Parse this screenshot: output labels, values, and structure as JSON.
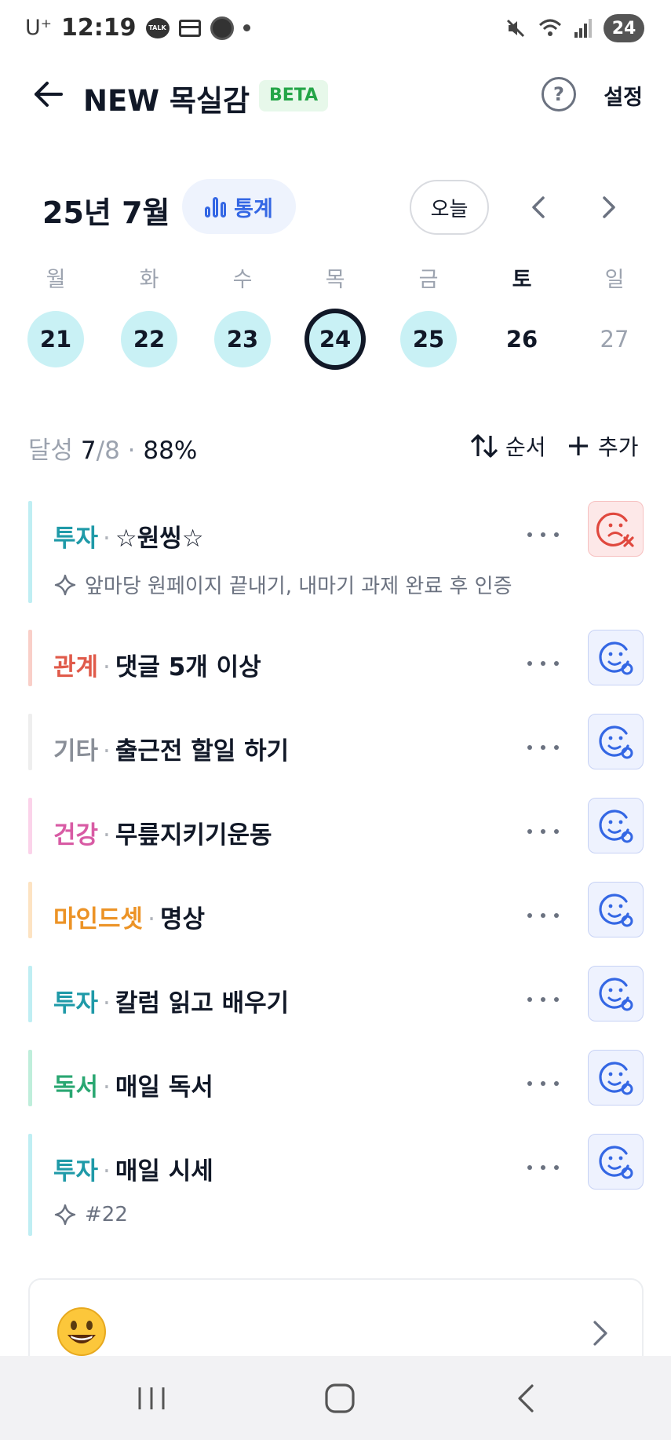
{
  "status_bar": {
    "carrier": "U⁺",
    "time": "12:19",
    "talk_label": "TALK",
    "battery": "24"
  },
  "header": {
    "title": "NEW 목실감",
    "badge": "BETA",
    "help_label": "?",
    "settings_label": "설정"
  },
  "calendar": {
    "month_label": "25년 7월",
    "stats_label": "통계",
    "today_label": "오늘",
    "weekdays": [
      "월",
      "화",
      "수",
      "목",
      "금",
      "토",
      "일"
    ],
    "days": [
      {
        "num": "21",
        "state": "done"
      },
      {
        "num": "22",
        "state": "done"
      },
      {
        "num": "23",
        "state": "done"
      },
      {
        "num": "24",
        "state": "today"
      },
      {
        "num": "25",
        "state": "done"
      },
      {
        "num": "26",
        "state": "none"
      },
      {
        "num": "27",
        "state": "future"
      }
    ]
  },
  "summary": {
    "label": "달성",
    "done": "7",
    "total": "/8",
    "dot": "·",
    "percent": "88%",
    "order_label": "순서",
    "add_label": "추가"
  },
  "goals": [
    {
      "category": "투자",
      "name": "☆원씽☆",
      "color": "#1f9aa8",
      "bar": "#bfeef3",
      "status": "failed",
      "note": "앞마당 원페이지 끝내기, 내마기 과제 완료 후 인증"
    },
    {
      "category": "관계",
      "name": "댓글 5개 이상",
      "color": "#e05a4a",
      "bar": "#f9cfc8",
      "status": "pending",
      "note": ""
    },
    {
      "category": "기타",
      "name": "출근전 할일 하기",
      "color": "#8a8f98",
      "bar": "#eeeeee",
      "status": "pending",
      "note": ""
    },
    {
      "category": "건강",
      "name": "무릎지키기운동",
      "color": "#d85ba4",
      "bar": "#fbd3ea",
      "status": "pending",
      "note": ""
    },
    {
      "category": "마인드셋",
      "name": "명상",
      "color": "#ec9326",
      "bar": "#fde3c2",
      "status": "pending",
      "note": ""
    },
    {
      "category": "투자",
      "name": "칼럼 읽고 배우기",
      "color": "#1f9aa8",
      "bar": "#bfeef3",
      "status": "pending",
      "note": ""
    },
    {
      "category": "독서",
      "name": "매일 독서",
      "color": "#2aa772",
      "bar": "#bfeedb",
      "status": "pending",
      "note": ""
    },
    {
      "category": "투자",
      "name": "매일 시세",
      "color": "#1f9aa8",
      "bar": "#bfeef3",
      "status": "pending",
      "note": "#22"
    }
  ],
  "goal_separator": "·",
  "emoji_card": {
    "icon": "grinning-face"
  },
  "nav_bar": {
    "items": [
      "recent-apps",
      "home",
      "back"
    ]
  }
}
